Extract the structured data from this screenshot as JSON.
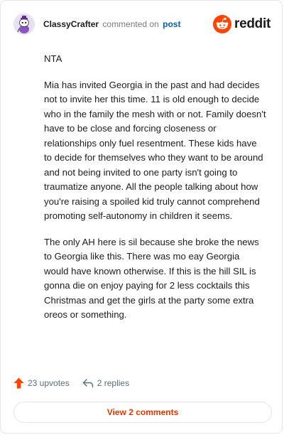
{
  "header": {
    "username": "ClassyCrafter",
    "action_text": "commented on",
    "post_link": "post",
    "brand": "reddit"
  },
  "comment": {
    "paragraphs": [
      "NTA",
      "Mia has invited Georgia in the past and had decides not to invite her this time. 11 is old enough to decide who in the family the mesh with or not. Family doesn't have to be close and forcing closeness or relationships only fuel resentment. These kids have to decide for themselves who they want to be around and not being invited to one party isn't going to traumatize anyone. All the people talking about how you're raising a spoiled kid truly cannot comprehend promoting self-autonomy in children it seems.",
      "The only AH here is sil because she broke the news to Georgia like this. There was mo eay Georgia would have known otherwise. If this is the hill SIL is gonna die on enjoy paying for 2 less cocktails this Christmas and get the girls at the party some extra oreos or something."
    ]
  },
  "actions": {
    "upvotes": "23 upvotes",
    "replies": "2 replies"
  },
  "footer": {
    "view_comments": "View 2 comments"
  },
  "icons": {
    "upvote": "upvote-arrow-icon",
    "reply": "reply-icon",
    "brand": "reddit-snoo-icon",
    "avatar": "avatar-icon"
  },
  "colors": {
    "accent": "#d93a00",
    "brand_orange": "#ff4500",
    "link_blue": "#0a5ea8",
    "muted": "#576f76"
  }
}
